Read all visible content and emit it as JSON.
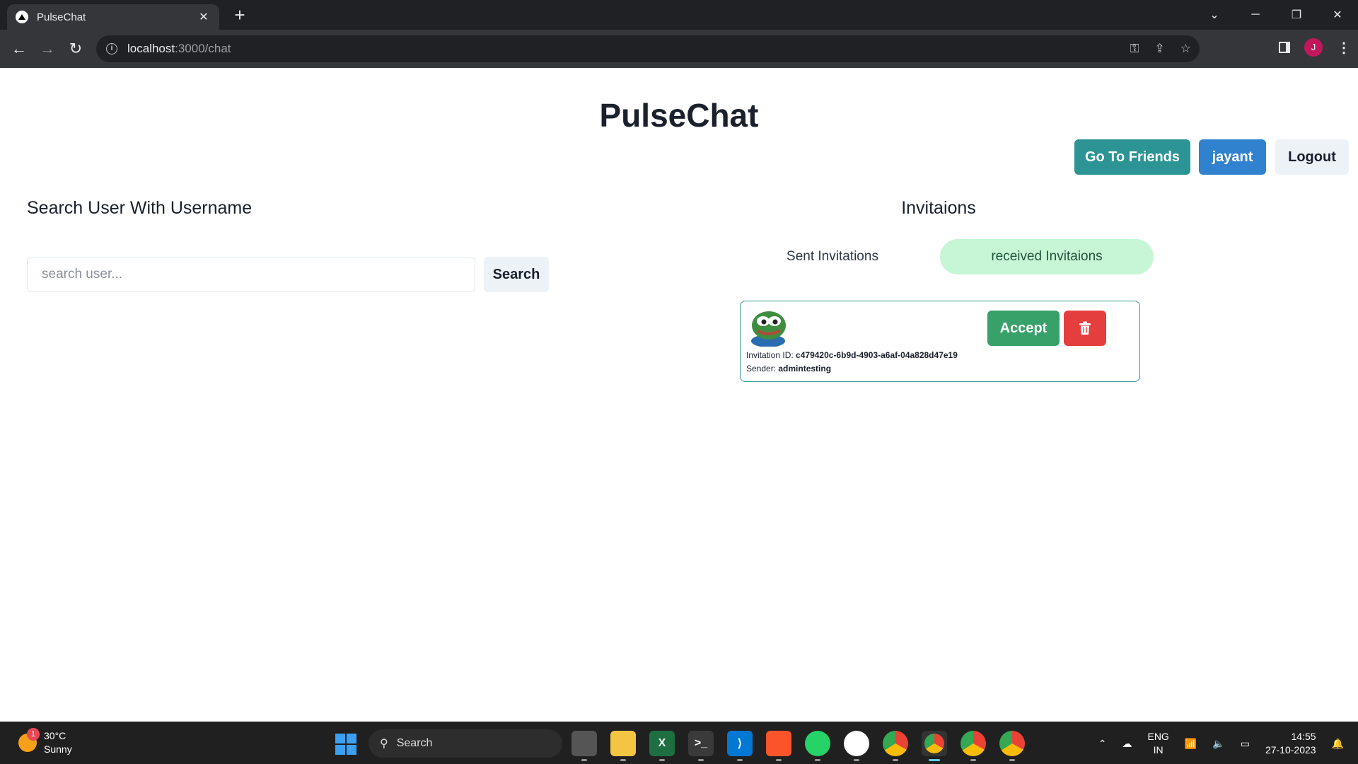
{
  "browser": {
    "tab_title": "PulseChat",
    "tab_close": "✕",
    "new_tab": "+",
    "url_host": "localhost",
    "url_path": ":3000/chat",
    "profile_initial": "J"
  },
  "app": {
    "title": "PulseChat",
    "nav": {
      "friends_label": "Go To Friends",
      "user_label": "jayant",
      "logout_label": "Logout"
    },
    "search": {
      "heading": "Search User With Username",
      "placeholder": "search user...",
      "button_label": "Search"
    },
    "invitations": {
      "heading": "Invitaions",
      "tab_sent": "Sent Invitations",
      "tab_received": "received Invitaions",
      "active_tab": "received",
      "items": [
        {
          "id_label": "Invitation ID:",
          "id_value": "c479420c-6b9d-4903-a6af-04a828d47e19",
          "sender_label": "Sender:",
          "sender_value": "admintesting",
          "accept_label": "Accept"
        }
      ]
    }
  },
  "taskbar": {
    "weather_temp": "30°C",
    "weather_desc": "Sunny",
    "weather_badge": "1",
    "search_label": "Search",
    "lang_line1": "ENG",
    "lang_line2": "IN",
    "time": "14:55",
    "date": "27-10-2023"
  },
  "colors": {
    "friends_button": "#2c9494",
    "user_button": "#3182ce",
    "accept_button": "#38a169",
    "delete_button": "#e53e3e",
    "active_tab_bg": "#c6f6d5"
  }
}
